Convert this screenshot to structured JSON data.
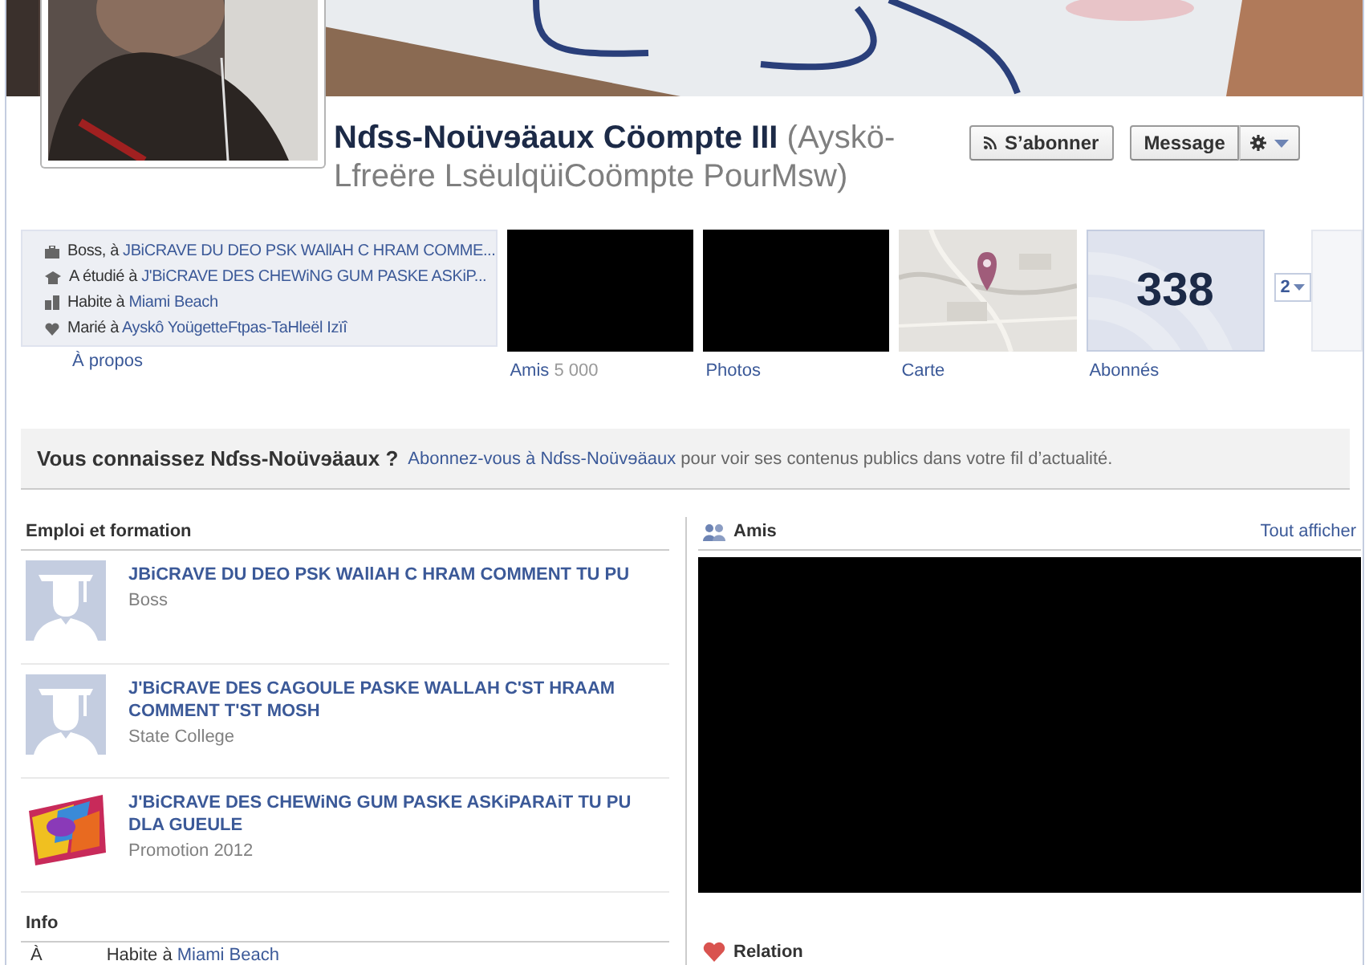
{
  "profile": {
    "name": "Nɗss-Noüvɘäaux Cöompte III",
    "alternate_name": "(Ayskö-Lfreëre LsëulqüiCoömpte PourMsw)"
  },
  "actions": [
    {
      "kind": "subscribe",
      "label": "S’abonner"
    },
    {
      "kind": "message",
      "label": "Message"
    },
    {
      "kind": "settings"
    }
  ],
  "intro": [
    {
      "kind": "work",
      "prefix": "Boss, à ",
      "link": "JBiCRAVE DU DEO PSK WAllAH C HRAM COMME..."
    },
    {
      "kind": "school",
      "prefix": "A étudié à ",
      "link": "J'BiCRAVE DES CHEWiNG GUM PASKE ASKiP..."
    },
    {
      "kind": "home",
      "prefix": "Habite à ",
      "link": "Miami Beach"
    },
    {
      "kind": "heart",
      "prefix": "Marié à ",
      "link": "Ayskô YoügetteFtpas-TaHleël Izïî"
    }
  ],
  "about_link": "À propos",
  "tiles": [
    {
      "kind": "redacted",
      "label": "Amis",
      "count": "5 000"
    },
    {
      "kind": "redacted",
      "label": "Photos"
    },
    {
      "kind": "map",
      "label": "Carte"
    },
    {
      "kind": "count",
      "value": "338",
      "label": "Abonnés"
    }
  ],
  "more_tiles": {
    "count": "2"
  },
  "suggest": {
    "title": "Vous connaissez Nɗss-Noüvɘäaux ?",
    "link": "Abonnez-vous à Nɗss-Noüvɘäaux",
    "text": " pour voir ses contenus publics dans votre fil d’actualité."
  },
  "work_education": {
    "title": "Emploi et formation",
    "items": [
      {
        "kind": "silhouette",
        "title": "JBiCRAVE DU DEO PSK WAllAH C HRAM COMMENT TU PU",
        "subtitle": "Boss"
      },
      {
        "kind": "silhouette",
        "title": "J'BiCRAVE DES CAGOULE PASKE WALLAH C'ST HRAAM COMMENT T'ST MOSH",
        "subtitle": "State College"
      },
      {
        "kind": "picture",
        "title": "J'BiCRAVE DES CHEWiNG GUM PASKE ASKiPARAiT TU PU DLA GUEULE",
        "subtitle": "Promotion 2012"
      }
    ]
  },
  "info": {
    "title": "Info",
    "rows": [
      {
        "label": "À",
        "value_prefix": "Habite à ",
        "value_link": "Miami Beach"
      }
    ]
  },
  "friends": {
    "title": "Amis",
    "see_all": "Tout afficher"
  },
  "relation": {
    "title": "Relation"
  }
}
